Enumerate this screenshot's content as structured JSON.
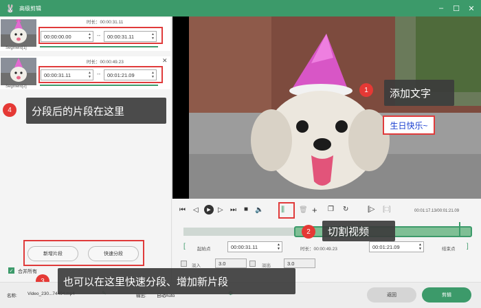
{
  "window": {
    "title": "高级剪辑"
  },
  "segments": [
    {
      "label": "Segment[1]",
      "duration": "时长：00:00:31.11",
      "start": "00:00:00.00",
      "end": "00:00:31.11",
      "separator": "--"
    },
    {
      "label": "Segment[2]",
      "duration": "时长：00:00:49.23",
      "start": "00:00:31.11",
      "end": "00:01:21.09",
      "separator": "--"
    }
  ],
  "left_buttons": {
    "add_segment": "新增片段",
    "quick_split": "快速分段"
  },
  "merge": {
    "label": "合并所有",
    "checked": true
  },
  "callouts": {
    "c1": {
      "num": "1",
      "text": "添加文字"
    },
    "c2": {
      "num": "2",
      "text": "切割视频"
    },
    "c3": {
      "num": "3",
      "text": "也可以在这里快速分段、增加新片段"
    },
    "c4": {
      "num": "4",
      "text": "分段后的片段在这里"
    }
  },
  "video": {
    "overlay_text": "生日快乐~"
  },
  "controls": {
    "time_display": "00:01:17.13/00:01:21.09",
    "start_point_label": "起始点",
    "start_value": "00:00:31.11",
    "duration_label": "时长：00:00:49.23",
    "end_value": "00:01:21.09",
    "end_point_label": "结束点",
    "fade_in_label": "淡入",
    "fade_in_value": "3.0",
    "fade_out_label": "淡出",
    "fade_out_value": "3.0",
    "progress": 0.954,
    "selection_start": 0.384
  },
  "bottom": {
    "name_label": "名称:",
    "filename": "Video_230...74404.mp4",
    "output_label": "输出:",
    "output_value": "自动Auto",
    "back_button": "返回",
    "cut_button": "剪辑"
  },
  "colors": {
    "accent": "#3c9a6a",
    "highlight": "#e03a3a",
    "callout_bg": "#3c3c3c"
  }
}
